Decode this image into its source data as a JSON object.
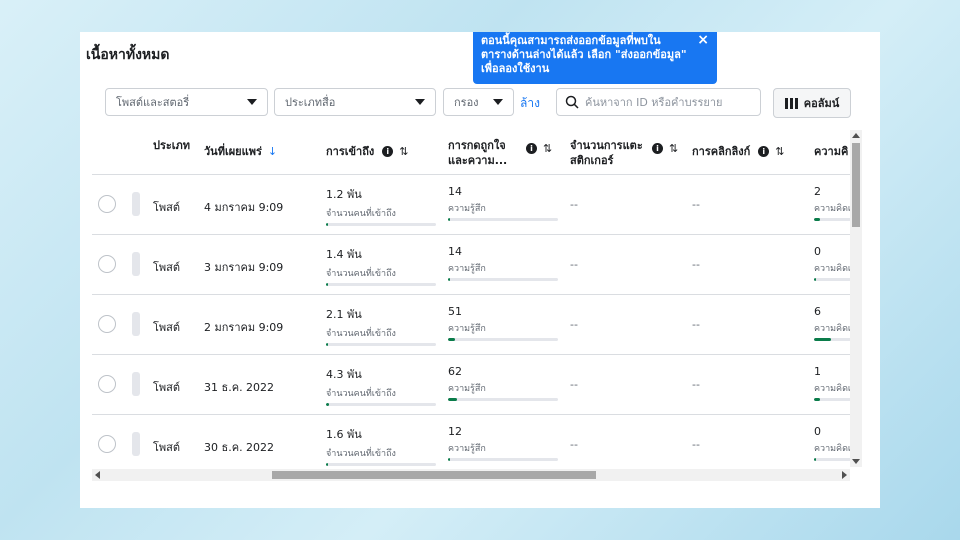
{
  "page_title": "เนื้อหาทั้งหมด",
  "tooltip": {
    "text": "ตอนนี้คุณสามารถส่งออกข้อมูลที่พบในตารางด้านล่างได้แล้ว เลือก \"ส่งออกข้อมูล\" เพื่อลองใช้งาน",
    "close": "×"
  },
  "filters": {
    "posts_stories": "โพสต์และสตอรี่",
    "media_type": "ประเภทสื่อ",
    "filter": "กรอง",
    "clear": "ล้าง",
    "search_placeholder": "ค้นหาจาก ID หรือคำบรรยาย",
    "columns": "คอลัมน์"
  },
  "table": {
    "headers": {
      "type": "ประเภท",
      "date": "วันที่เผยแพร่",
      "reach": "การเข้าถึง",
      "reactions": "การกดถูกใจและความ...",
      "stickers": "จำนวนการแตะสติกเกอร์",
      "link_clicks": "การคลิกลิงก์",
      "comments": "ความคิ"
    },
    "rows": [
      {
        "type": "โพสต์",
        "date": "4 มกราคม 9:09",
        "reach": "1.2 พัน",
        "reach_sub": "จำนวนคนที่เข้าถึง",
        "reach_level": 0.02,
        "reactions": "14",
        "reactions_sub": "ความรู้สึก",
        "reactions_level": 0.02,
        "stickers": "--",
        "link_clicks": "--",
        "comments": "2",
        "comments_sub": "ความคิดเ",
        "comments_level": 0.05
      },
      {
        "type": "โพสต์",
        "date": "3 มกราคม 9:09",
        "reach": "1.4 พัน",
        "reach_sub": "จำนวนคนที่เข้าถึง",
        "reach_level": 0.02,
        "reactions": "14",
        "reactions_sub": "ความรู้สึก",
        "reactions_level": 0.02,
        "stickers": "--",
        "link_clicks": "--",
        "comments": "0",
        "comments_sub": "ความคิดเ",
        "comments_level": 0.0
      },
      {
        "type": "โพสต์",
        "date": "2 มกราคม 9:09",
        "reach": "2.1 พัน",
        "reach_sub": "จำนวนคนที่เข้าถึง",
        "reach_level": 0.02,
        "reactions": "51",
        "reactions_sub": "ความรู้สึก",
        "reactions_level": 0.06,
        "stickers": "--",
        "link_clicks": "--",
        "comments": "6",
        "comments_sub": "ความคิดเ",
        "comments_level": 0.15
      },
      {
        "type": "โพสต์",
        "date": "31 ธ.ค. 2022",
        "reach": "4.3 พัน",
        "reach_sub": "จำนวนคนที่เข้าถึง",
        "reach_level": 0.03,
        "reactions": "62",
        "reactions_sub": "ความรู้สึก",
        "reactions_level": 0.08,
        "stickers": "--",
        "link_clicks": "--",
        "comments": "1",
        "comments_sub": "ความคิดเ",
        "comments_level": 0.05
      },
      {
        "type": "โพสต์",
        "date": "30 ธ.ค. 2022",
        "reach": "1.6 พัน",
        "reach_sub": "จำนวนคนที่เข้าถึง",
        "reach_level": 0.02,
        "reactions": "12",
        "reactions_sub": "ความรู้สึก",
        "reactions_level": 0.02,
        "stickers": "--",
        "link_clicks": "--",
        "comments": "0",
        "comments_sub": "ความคิดเ",
        "comments_level": 0.0
      }
    ]
  },
  "colors": {
    "accent": "#1877f2",
    "bar_fill": "#0a7c4a"
  }
}
